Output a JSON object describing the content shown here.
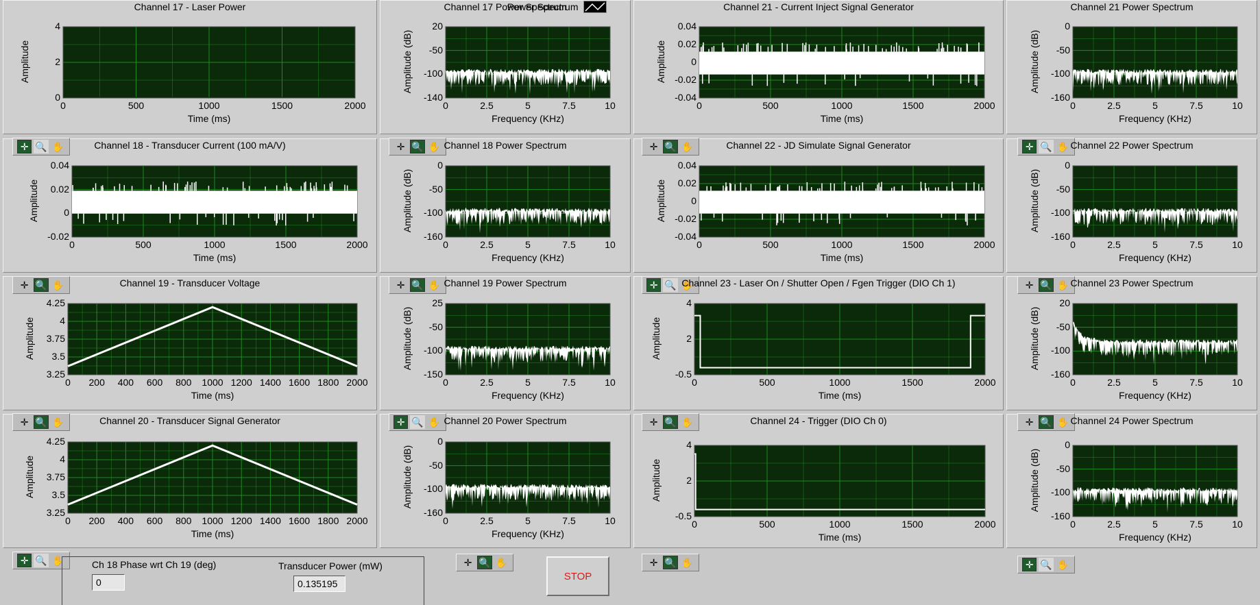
{
  "colors": {
    "plot_bg": "#0a2a0a",
    "grid": "#1f8a1f",
    "trace": "#ffffff",
    "stop_text": "#e01818"
  },
  "legend": {
    "label": "Power Spectrum"
  },
  "graphs": [
    {
      "id": "ch17",
      "title": "Channel 17 - Laser Power",
      "xlabel": "Time (ms)",
      "ylabel": "Amplitude",
      "xticks": [
        "0",
        "500",
        "1000",
        "1500",
        "2000"
      ],
      "yticks": [
        "4",
        "2",
        "0"
      ],
      "signal": "flat"
    },
    {
      "id": "ch17ps",
      "title": "Channel 17 Power Spectrum",
      "xlabel": "Frequency (KHz)",
      "ylabel": "Amplitude (dB)",
      "xticks": [
        "0",
        "2.5",
        "5",
        "7.5",
        "10"
      ],
      "yticks": [
        "20",
        "-50",
        "-100",
        "-140"
      ],
      "signal": "noise"
    },
    {
      "id": "ch21",
      "title": "Channel 21 - Current Inject Signal Generator",
      "xlabel": "Time (ms)",
      "ylabel": "Amplitude",
      "xticks": [
        "0",
        "500",
        "1000",
        "1500",
        "2000"
      ],
      "yticks": [
        "0.04",
        "0.02",
        "0",
        "-0.02",
        "-0.04"
      ],
      "signal": "band"
    },
    {
      "id": "ch21ps",
      "title": "Channel 21 Power Spectrum",
      "xlabel": "Frequency (KHz)",
      "ylabel": "Amplitude (dB)",
      "xticks": [
        "0",
        "2.5",
        "5",
        "7.5",
        "10"
      ],
      "yticks": [
        "0",
        "-50",
        "-100",
        "-160"
      ],
      "signal": "noise"
    },
    {
      "id": "ch18",
      "title": "Channel 18 - Transducer Current (100 mA/V)",
      "xlabel": "Time (ms)",
      "ylabel": "Amplitude",
      "xticks": [
        "0",
        "500",
        "1000",
        "1500",
        "2000"
      ],
      "yticks": [
        "0.04",
        "0.02",
        "0",
        "-0.02"
      ],
      "signal": "band"
    },
    {
      "id": "ch18ps",
      "title": "Channel 18 Power Spectrum",
      "xlabel": "Frequency (KHz)",
      "ylabel": "Amplitude (dB)",
      "xticks": [
        "0",
        "2.5",
        "5",
        "7.5",
        "10"
      ],
      "yticks": [
        "0",
        "-50",
        "-100",
        "-160"
      ],
      "signal": "noise"
    },
    {
      "id": "ch22",
      "title": "Channel 22 - JD Simulate Signal Generator",
      "xlabel": "Time (ms)",
      "ylabel": "Amplitude",
      "xticks": [
        "0",
        "500",
        "1000",
        "1500",
        "2000"
      ],
      "yticks": [
        "0.04",
        "0.02",
        "0",
        "-0.02",
        "-0.04"
      ],
      "signal": "band"
    },
    {
      "id": "ch22ps",
      "title": "Channel 22 Power Spectrum",
      "xlabel": "Frequency (KHz)",
      "ylabel": "Amplitude (dB)",
      "xticks": [
        "0",
        "2.5",
        "5",
        "7.5",
        "10"
      ],
      "yticks": [
        "0",
        "-50",
        "-100",
        "-160"
      ],
      "signal": "noise"
    },
    {
      "id": "ch19",
      "title": "Channel 19 - Transducer Voltage",
      "xlabel": "Time (ms)",
      "ylabel": "Amplitude",
      "xticks": [
        "0",
        "200",
        "400",
        "600",
        "800",
        "1000",
        "1200",
        "1400",
        "1600",
        "1800",
        "2000"
      ],
      "yticks": [
        "4.25",
        "4",
        "3.75",
        "3.5",
        "3.25"
      ],
      "signal": "triangle"
    },
    {
      "id": "ch19ps",
      "title": "Channel 19 Power Spectrum",
      "xlabel": "Frequency (KHz)",
      "ylabel": "Amplitude (dB)",
      "xticks": [
        "0",
        "2.5",
        "5",
        "7.5",
        "10"
      ],
      "yticks": [
        "25",
        "-50",
        "-100",
        "-150"
      ],
      "signal": "noise"
    },
    {
      "id": "ch23",
      "title": "Channel 23 - Laser On / Shutter Open / Fgen Trigger   (DIO Ch 1)",
      "xlabel": "Time (ms)",
      "ylabel": "Amplitude",
      "xticks": [
        "0",
        "500",
        "1000",
        "1500",
        "2000"
      ],
      "yticks": [
        "4",
        "2",
        "-0.5"
      ],
      "signal": "gate"
    },
    {
      "id": "ch23ps",
      "title": "Channel 23 Power Spectrum",
      "xlabel": "Frequency (KHz)",
      "ylabel": "Amplitude (dB)",
      "xticks": [
        "0",
        "2.5",
        "5",
        "7.5",
        "10"
      ],
      "yticks": [
        "20",
        "-50",
        "-100",
        "-160"
      ],
      "signal": "decay"
    },
    {
      "id": "ch20",
      "title": "Channel 20 - Transducer Signal Generator",
      "xlabel": "Time (ms)",
      "ylabel": "Amplitude",
      "xticks": [
        "0",
        "200",
        "400",
        "600",
        "800",
        "1000",
        "1200",
        "1400",
        "1600",
        "1800",
        "2000"
      ],
      "yticks": [
        "4.25",
        "4",
        "3.75",
        "3.5",
        "3.25"
      ],
      "signal": "triangle"
    },
    {
      "id": "ch20ps",
      "title": "Channel 20 Power Spectrum",
      "xlabel": "Frequency (KHz)",
      "ylabel": "Amplitude (dB)",
      "xticks": [
        "0",
        "2.5",
        "5",
        "7.5",
        "10"
      ],
      "yticks": [
        "0",
        "-50",
        "-100",
        "-160"
      ],
      "signal": "noise"
    },
    {
      "id": "ch24",
      "title": "Channel 24 - Trigger (DIO Ch 0)",
      "xlabel": "Time (ms)",
      "ylabel": "Amplitude",
      "xticks": [
        "0",
        "500",
        "1000",
        "1500",
        "2000"
      ],
      "yticks": [
        "4",
        "2",
        "-0.5"
      ],
      "signal": "pulse"
    },
    {
      "id": "ch24ps",
      "title": "Channel 24 Power Spectrum",
      "xlabel": "Frequency (KHz)",
      "ylabel": "Amplitude (dB)",
      "xticks": [
        "0",
        "2.5",
        "5",
        "7.5",
        "10"
      ],
      "yticks": [
        "0",
        "-50",
        "-100",
        "-160"
      ],
      "signal": "noise"
    }
  ],
  "controls": {
    "phase_label": "Ch 18 Phase wrt Ch 19 (deg)",
    "phase_value": "0",
    "power_label": "Transducer Power (mW)",
    "power_value": "0.135195",
    "stop_label": "STOP"
  }
}
